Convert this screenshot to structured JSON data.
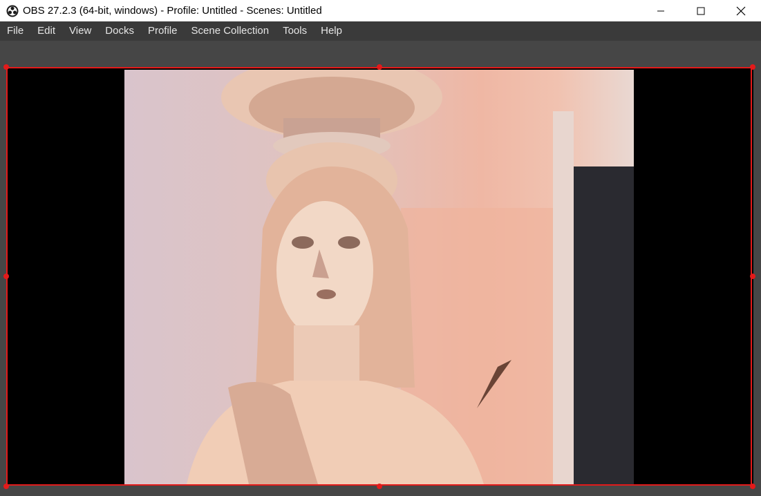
{
  "window": {
    "title": "OBS 27.2.3 (64-bit, windows) - Profile: Untitled - Scenes: Untitled",
    "app_icon": "obs-logo-icon",
    "controls": [
      "minimize-icon",
      "maximize-icon",
      "close-icon"
    ]
  },
  "menubar": {
    "items": [
      "File",
      "Edit",
      "View",
      "Docks",
      "Profile",
      "Scene Collection",
      "Tools",
      "Help"
    ]
  },
  "preview": {
    "source_content": "caryatid-statue-video-frame",
    "selection_color": "#e31a1a"
  }
}
